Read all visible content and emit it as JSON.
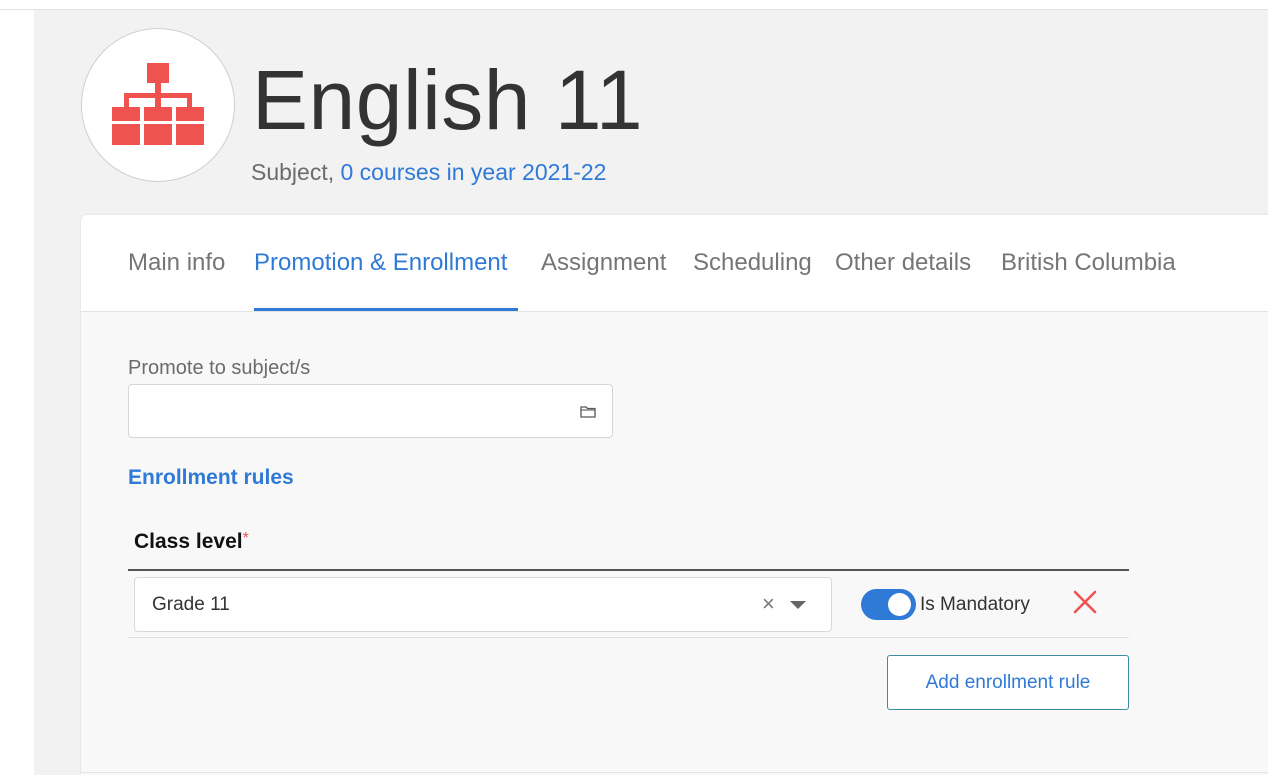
{
  "header": {
    "title": "English 11",
    "subtitle_prefix": "Subject, ",
    "subtitle_link": "0 courses in year 2021-22",
    "avatar_icon": "hierarchy-icon",
    "avatar_color": "#ef5350"
  },
  "tabs": [
    {
      "label": "Main info",
      "active": false
    },
    {
      "label": "Promotion & Enrollment",
      "active": true
    },
    {
      "label": "Assignment",
      "active": false
    },
    {
      "label": "Scheduling",
      "active": false
    },
    {
      "label": "Other details",
      "active": false
    },
    {
      "label": "British Columbia",
      "active": false
    }
  ],
  "promote": {
    "label": "Promote to subject/s",
    "value": "",
    "icon": "folder-icon"
  },
  "enrollment": {
    "section_title": "Enrollment rules",
    "column_header": "Class level",
    "required_mark": "*",
    "rows": [
      {
        "class_level": "Grade 11",
        "clear_glyph": "×",
        "is_mandatory": true,
        "mandatory_label": "Is Mandatory"
      }
    ],
    "add_button_label": "Add enrollment rule"
  },
  "colors": {
    "accent": "#2f7ad6",
    "remove": "#ef5350"
  }
}
